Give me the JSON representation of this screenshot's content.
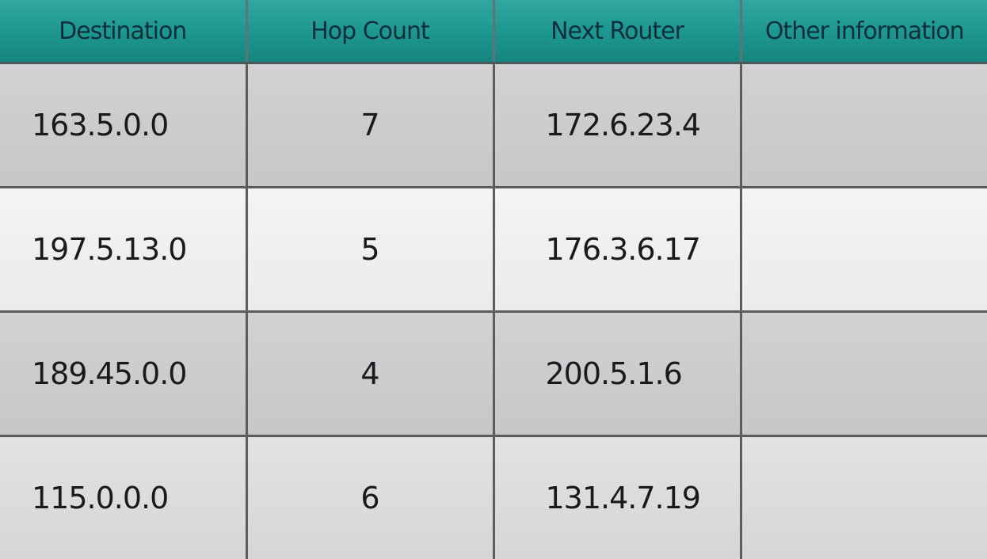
{
  "table": {
    "headers": {
      "destination": "Destination",
      "hop_count": "Hop Count",
      "next_router": "Next Router",
      "other_information": "Other information"
    },
    "rows": [
      {
        "destination": "163.5.0.0",
        "hop_count": "7",
        "next_router": "172.6.23.4",
        "other_information": ""
      },
      {
        "destination": "197.5.13.0",
        "hop_count": "5",
        "next_router": "176.3.6.17",
        "other_information": ""
      },
      {
        "destination": "189.45.0.0",
        "hop_count": "4",
        "next_router": "200.5.1.6",
        "other_information": ""
      },
      {
        "destination": "115.0.0.0",
        "hop_count": "6",
        "next_router": "131.4.7.19",
        "other_information": ""
      }
    ]
  },
  "colors": {
    "header_bg": "#1f9a92",
    "header_text": "#0d2f3c",
    "row_dark": "#cdcccf",
    "row_light": "#f0f0f0",
    "grid_line": "#5c5c5c"
  }
}
